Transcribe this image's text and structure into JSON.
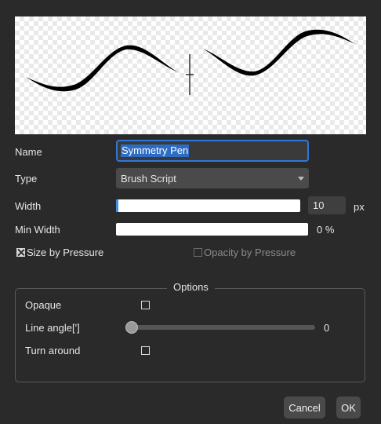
{
  "preview": {
    "description_icon": "symmetry-stroke-preview"
  },
  "form": {
    "name_label": "Name",
    "name_value": "Symmetry Pen",
    "type_label": "Type",
    "type_value": "Brush Script",
    "width_label": "Width",
    "width_value": "10",
    "width_unit": "px",
    "width_fill_fraction": 0.01,
    "min_width_label": "Min Width",
    "min_width_value": "0 %",
    "size_by_pressure_label": "Size by Pressure",
    "size_by_pressure_checked": true,
    "opacity_by_pressure_label": "Opacity by Pressure",
    "opacity_by_pressure_checked": false
  },
  "options": {
    "title": "Options",
    "opaque_label": "Opaque",
    "line_angle_label": "Line angle[']",
    "line_angle_value": "0",
    "turn_around_label": "Turn around"
  },
  "buttons": {
    "cancel": "Cancel",
    "ok": "OK"
  },
  "colors": {
    "accent": "#2f78d8",
    "background": "#2a2a2a",
    "control": "#4a4a4a"
  }
}
